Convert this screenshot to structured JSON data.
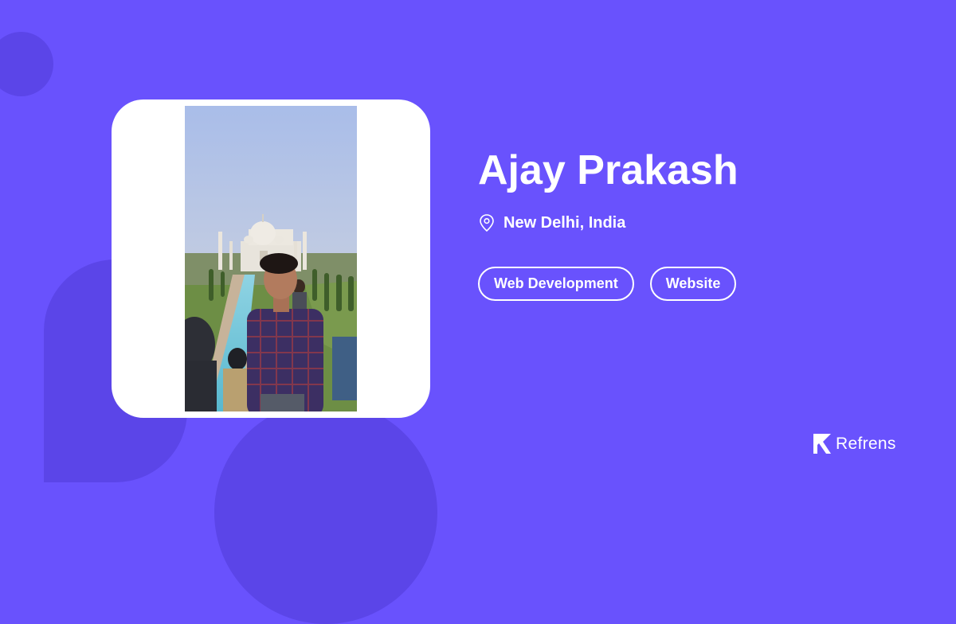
{
  "profile": {
    "name": "Ajay Prakash",
    "location": "New Delhi, India",
    "location_icon": "map-pin-icon",
    "tags": [
      "Web Development",
      "Website"
    ]
  },
  "photo": {
    "alt": "Ajay Prakash"
  },
  "brand": {
    "name": "Refrens",
    "icon": "refrens-logo"
  },
  "colors": {
    "background": "#6952fd",
    "shape": "#5b45e8",
    "card": "#ffffff",
    "text": "#ffffff"
  }
}
